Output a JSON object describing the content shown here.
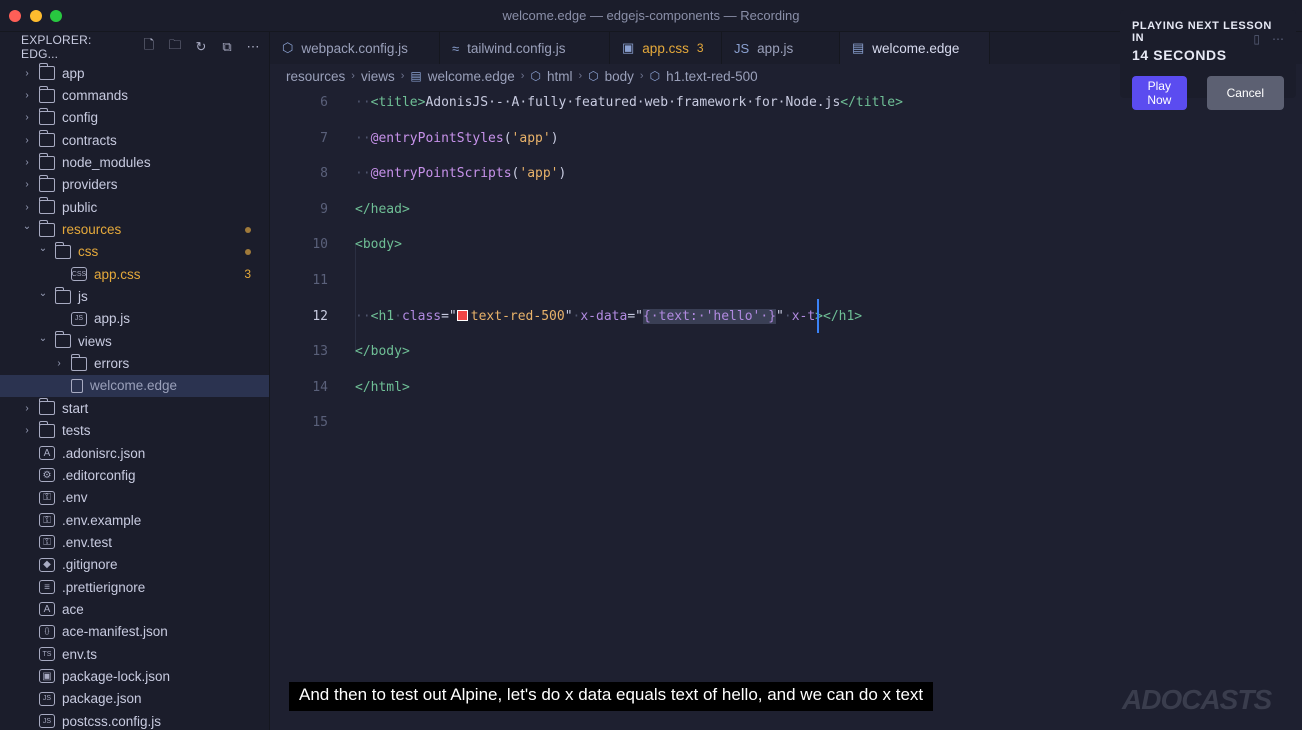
{
  "window": {
    "title": "welcome.edge — edgejs-components — Recording"
  },
  "explorer": {
    "title": "EXPLORER: EDG...",
    "tree": [
      {
        "label": "app",
        "kind": "folder",
        "depth": 0,
        "open": false
      },
      {
        "label": "commands",
        "kind": "folder",
        "depth": 0,
        "open": false
      },
      {
        "label": "config",
        "kind": "folder",
        "depth": 0,
        "open": false
      },
      {
        "label": "contracts",
        "kind": "folder",
        "depth": 0,
        "open": false
      },
      {
        "label": "node_modules",
        "kind": "folder",
        "depth": 0,
        "open": false
      },
      {
        "label": "providers",
        "kind": "folder",
        "depth": 0,
        "open": false
      },
      {
        "label": "public",
        "kind": "folder",
        "depth": 0,
        "open": false
      },
      {
        "label": "resources",
        "kind": "folder",
        "depth": 0,
        "open": true,
        "modified": true
      },
      {
        "label": "css",
        "kind": "folder",
        "depth": 1,
        "open": true,
        "modified": true
      },
      {
        "label": "app.css",
        "kind": "file",
        "depth": 2,
        "modified": true,
        "badge": "3",
        "icon": "CSS"
      },
      {
        "label": "js",
        "kind": "folder",
        "depth": 1,
        "open": true
      },
      {
        "label": "app.js",
        "kind": "file",
        "depth": 2,
        "icon": "JS"
      },
      {
        "label": "views",
        "kind": "folder",
        "depth": 1,
        "open": true
      },
      {
        "label": "errors",
        "kind": "folder",
        "depth": 2,
        "open": false
      },
      {
        "label": "welcome.edge",
        "kind": "file",
        "depth": 2,
        "active": true
      },
      {
        "label": "start",
        "kind": "folder",
        "depth": 0,
        "open": false
      },
      {
        "label": "tests",
        "kind": "folder",
        "depth": 0,
        "open": false
      },
      {
        "label": ".adonisrc.json",
        "kind": "file",
        "depth": 0,
        "icon": "A"
      },
      {
        "label": ".editorconfig",
        "kind": "file",
        "depth": 0,
        "icon": "⚙"
      },
      {
        "label": ".env",
        "kind": "file",
        "depth": 0,
        "icon": "⚿"
      },
      {
        "label": ".env.example",
        "kind": "file",
        "depth": 0,
        "icon": "⚿"
      },
      {
        "label": ".env.test",
        "kind": "file",
        "depth": 0,
        "icon": "⚿"
      },
      {
        "label": ".gitignore",
        "kind": "file",
        "depth": 0,
        "icon": "◆"
      },
      {
        "label": ".prettierignore",
        "kind": "file",
        "depth": 0,
        "icon": "≡"
      },
      {
        "label": "ace",
        "kind": "file",
        "depth": 0,
        "icon": "A"
      },
      {
        "label": "ace-manifest.json",
        "kind": "file",
        "depth": 0,
        "icon": "{}"
      },
      {
        "label": "env.ts",
        "kind": "file",
        "depth": 0,
        "icon": "TS"
      },
      {
        "label": "package-lock.json",
        "kind": "file",
        "depth": 0,
        "icon": "▣"
      },
      {
        "label": "package.json",
        "kind": "file",
        "depth": 0,
        "icon": "JS"
      },
      {
        "label": "postcss.config.js",
        "kind": "file",
        "depth": 0,
        "icon": "JS"
      }
    ]
  },
  "tabs": [
    {
      "label": "webpack.config.js",
      "icon": "⬡"
    },
    {
      "label": "tailwind.config.js",
      "icon": "≈"
    },
    {
      "label": "app.css",
      "icon": "▣",
      "badge": "3",
      "modified": true
    },
    {
      "label": "app.js",
      "icon": "JS"
    },
    {
      "label": "welcome.edge",
      "icon": "▤",
      "active": true,
      "unsaved": true
    }
  ],
  "breadcrumbs": [
    "resources",
    "views",
    "welcome.edge",
    "html",
    "body",
    "h1.text-red-500"
  ],
  "editor": {
    "lines": [
      {
        "n": "6",
        "parts": [
          [
            "ws",
            "··"
          ],
          [
            "tag",
            "<title>"
          ],
          [
            "txt",
            "AdonisJS·-·A·fully·featured·web·framework·for·Node.js"
          ],
          [
            "tag",
            "</title>"
          ]
        ]
      },
      {
        "n": "7",
        "parts": [
          [
            "ws",
            "··"
          ],
          [
            "fn",
            "@entryPointStyles"
          ],
          [
            "txt",
            "("
          ],
          [
            "str",
            "'app'"
          ],
          [
            "txt",
            ")"
          ]
        ]
      },
      {
        "n": "8",
        "parts": [
          [
            "ws",
            "··"
          ],
          [
            "fn",
            "@entryPointScripts"
          ],
          [
            "txt",
            "("
          ],
          [
            "str",
            "'app'"
          ],
          [
            "txt",
            ")"
          ]
        ]
      },
      {
        "n": "9",
        "parts": [
          [
            "tag",
            "</head>"
          ]
        ]
      },
      {
        "n": "10",
        "parts": [
          [
            "tag",
            "<body>"
          ]
        ]
      },
      {
        "n": "11",
        "parts": []
      },
      {
        "n": "12",
        "current": true,
        "parts": [
          [
            "ws",
            "··"
          ],
          [
            "tag",
            "<h1"
          ],
          [
            "ws",
            "·"
          ],
          [
            "attr",
            "class"
          ],
          [
            "txt",
            "=\""
          ],
          [
            "swatch",
            ""
          ],
          [
            "str",
            "text-red-500"
          ],
          [
            "txt",
            "\""
          ],
          [
            "ws",
            "·"
          ],
          [
            "attr",
            "x-data"
          ],
          [
            "txt",
            "=\""
          ],
          [
            "sel",
            "{·text:·'hello'·}"
          ],
          [
            "txt",
            "\""
          ],
          [
            "ws",
            "·"
          ],
          [
            "attr",
            "x-t"
          ],
          [
            "tag",
            "></h1>"
          ]
        ]
      },
      {
        "n": "13",
        "parts": [
          [
            "tag",
            "</body>"
          ]
        ]
      },
      {
        "n": "14",
        "parts": [
          [
            "tag",
            "</html>"
          ]
        ]
      },
      {
        "n": "15",
        "parts": []
      }
    ]
  },
  "overlay": {
    "line1": "PLAYING NEXT LESSON IN",
    "line2": "14 SECONDS",
    "play": "Play Now",
    "cancel": "Cancel"
  },
  "caption": "And then to test out Alpine, let's do x data equals text of hello, and we can do x text",
  "logo": "ADOCASTS",
  "colors": {
    "accent": "#5b4cf0",
    "modified": "#e5a93b",
    "cursor": "#3b82f6"
  }
}
